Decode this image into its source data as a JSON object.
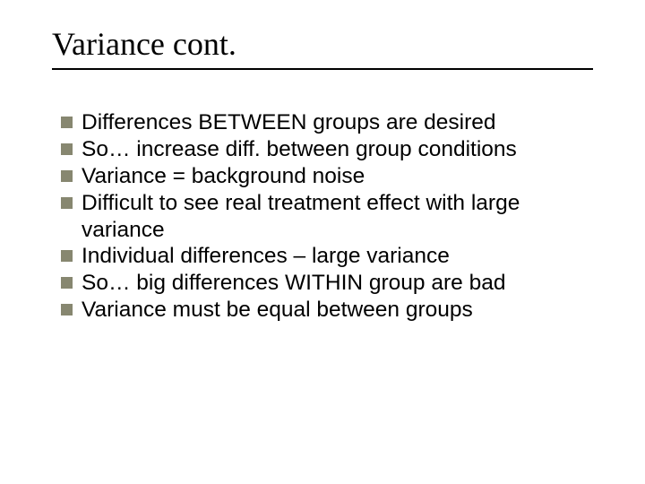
{
  "title": "Variance cont.",
  "bullets": [
    "Differences BETWEEN groups are desired",
    "So… increase diff. between group conditions",
    "Variance = background noise",
    "Difficult to see real treatment effect with large variance",
    "Individual differences – large variance",
    "So… big differences WITHIN group are bad",
    "Variance must be equal between groups"
  ]
}
